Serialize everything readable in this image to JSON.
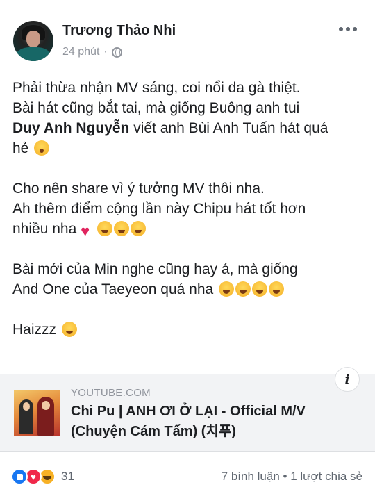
{
  "post": {
    "author": "Trương Thảo Nhi",
    "time": "24 phút",
    "separator": "·",
    "privacy_icon": "globe-icon",
    "more_icon": "more-options-icon",
    "paragraphs": {
      "p1_line1": "Phải thừa nhận MV sáng, coi nổi da gà thiệt.",
      "p1_line2": "Bài hát cũng bắt tai, mà giống Buông anh tui",
      "p1_mention": "Duy Anh Nguyễn",
      "p1_line3_rest": " viết anh Bùi Anh Tuấn hát quá",
      "p1_line4": "hẻ",
      "p2_line1": "Cho nên share vì ý tưởng MV thôi nha.",
      "p2_line2": "Ah thêm điểm cộng lần này Chipu hát tốt hơn",
      "p2_line3": "nhiều nha",
      "p3_line1": "Bài mới của Min nghe cũng hay á, mà giống",
      "p3_line2": "And One của Taeyeon quá nha",
      "p4": "Haizzz"
    }
  },
  "link_preview": {
    "domain": "YOUTUBE.COM",
    "title_line1": "Chi Pu | ANH ƠI Ở LẠI - Official M/V",
    "title_line2": "(Chuyện Cám Tấm) (치푸)",
    "info_label": "i"
  },
  "footer": {
    "reaction_icons": [
      "like-icon",
      "love-icon",
      "haha-icon"
    ],
    "reaction_count": "31",
    "stats": "7 bình luận • 1 lượt chia sẻ"
  }
}
